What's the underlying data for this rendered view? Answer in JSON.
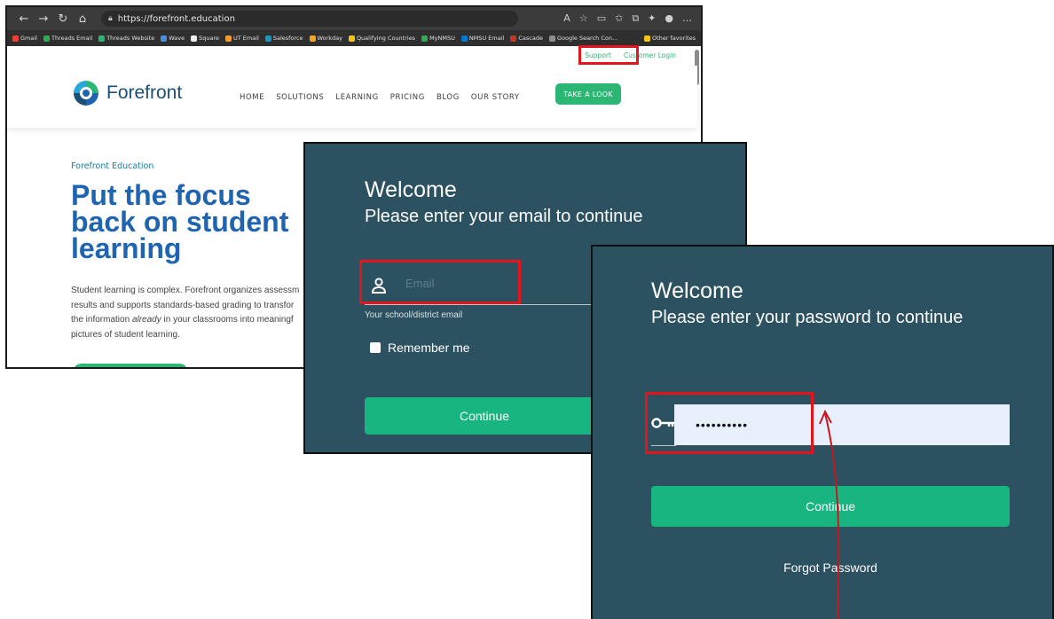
{
  "browser": {
    "url": "https://forefront.education",
    "bookmarks": [
      "Gmail",
      "Threads Email",
      "Threads Website",
      "Wave",
      "Square",
      "UT Email",
      "Salesforce",
      "Workday",
      "Qualifying Countries",
      "MyNMSU",
      "NMSU Email",
      "Cascade",
      "Google Search Con..."
    ],
    "other_favorites": "Other favorites"
  },
  "site": {
    "top_links": {
      "support": "Support",
      "customer_login": "Customer Login"
    },
    "logo_text": "Forefront",
    "nav": [
      "HOME",
      "SOLUTIONS",
      "LEARNING",
      "PRICING",
      "BLOG",
      "OUR STORY"
    ],
    "cta": "TAKE A LOOK",
    "hero": {
      "eyebrow": "Forefront Education",
      "title": "Put the focus back on student learning",
      "body_1": "Student learning is complex. Forefront organizes assessm",
      "body_2": "results and supports standards-based grading to transfor",
      "body_3a": "the information ",
      "body_3b": "already",
      "body_3c": " in your classrooms into meaningf",
      "body_4": "pictures of student learning."
    }
  },
  "email_dialog": {
    "welcome": "Welcome",
    "subtitle": "Please enter your email to continue",
    "email_placeholder": "Email",
    "email_help": "Your school/district email",
    "remember": "Remember me",
    "continue": "Continue"
  },
  "password_dialog": {
    "welcome": "Welcome",
    "subtitle": "Please enter your password to continue",
    "password_value": "••••••••••",
    "continue": "Continue",
    "forgot": "Forgot Password"
  },
  "colors": {
    "dialog_bg": "#2c5160",
    "button_green": "#18b580",
    "highlight_red": "#e3141b",
    "brand_blue": "#1f64b0"
  }
}
